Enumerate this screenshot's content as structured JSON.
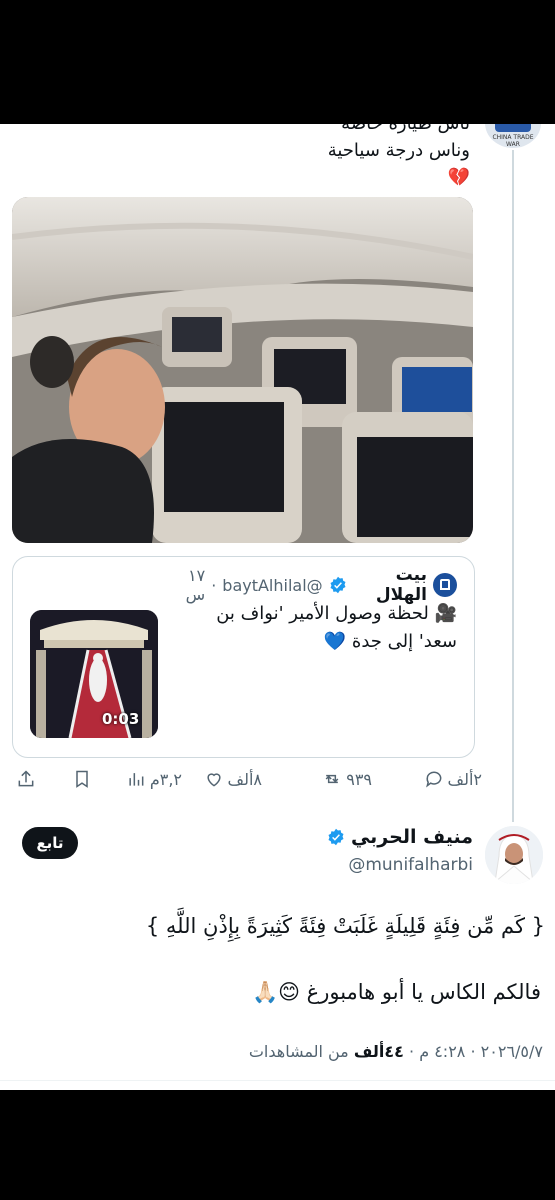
{
  "tweet1": {
    "text_line1": "ناس طيارة خاصة",
    "text_line2": "وناس درجة سياحية",
    "text_emoji": "💔",
    "avatar_caption": "CHINA TRADE WAR"
  },
  "quoted": {
    "name": "بيت الهلال",
    "handle": "@baytAlhilal",
    "time": "١٧ س",
    "separator": "·",
    "text_line1": "🎥 لحظة وصول الأمير 'نواف بن",
    "text_line2": "سعد' إلى جدة 💙",
    "video_duration": "0:03"
  },
  "actions": {
    "replies": "٢ألف",
    "retweets": "٩٣٩",
    "likes": "٨ألف",
    "views": "٣,٢م"
  },
  "reply": {
    "name": "منيف الحربي",
    "handle": "@munifalharbi",
    "follow_label": "تابع",
    "line1": "{ كَم مِّن فِئَةٍ قَلِيلَةٍ غَلَبَتْ فِئَةً كَثِيرَةً بِإِذْنِ اللَّهِ }",
    "line2": "فالكم الكاس يا أبو هامبورغ 😊🙏🏻",
    "date": "٢٠٢٦/٥/٧",
    "time": "٤:٢٨ م",
    "views_count": "٤٤ألف",
    "views_label": "من المشاهدات",
    "dot": "·"
  },
  "colors": {
    "verified_blue": "#1d9bf0",
    "muted": "#536471"
  }
}
